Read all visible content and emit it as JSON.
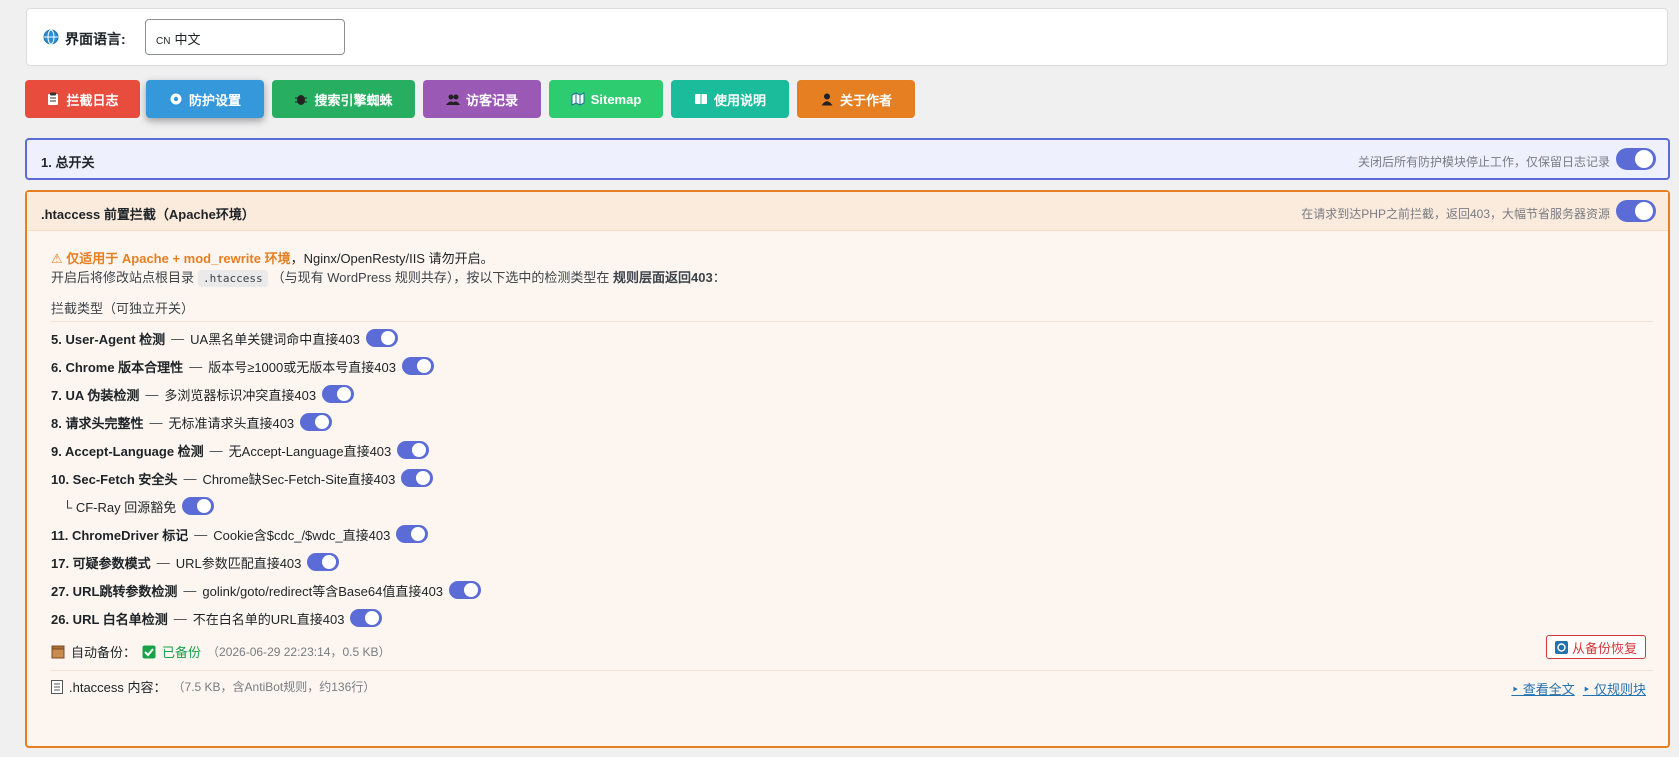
{
  "language": {
    "label": "界面语言:",
    "flag": "CN",
    "selected": "中文"
  },
  "tabs": [
    {
      "label": "拦截日志",
      "icon": "clipboard-icon",
      "color": "#e74c3c"
    },
    {
      "label": "防护设置",
      "icon": "gear-icon",
      "color": "#3498db"
    },
    {
      "label": "搜索引擎蜘蛛",
      "icon": "bug-icon",
      "color": "#27ae60"
    },
    {
      "label": "访客记录",
      "icon": "users-icon",
      "color": "#9b59b6"
    },
    {
      "label": "Sitemap",
      "icon": "map-icon",
      "color": "#2ecc71"
    },
    {
      "label": "使用说明",
      "icon": "book-icon",
      "color": "#1abc9c"
    },
    {
      "label": "关于作者",
      "icon": "user-icon",
      "color": "#e67e22"
    }
  ],
  "master": {
    "title": "1. 总开关",
    "hint": "关闭后所有防护模块停止工作，仅保留日志记录",
    "enabled": true
  },
  "htaccess": {
    "title": ".htaccess 前置拦截（Apache环境）",
    "hint": "在请求到达PHP之前拦截，返回403，大幅节省服务器资源",
    "enabled": true,
    "warn_highlight": "仅适用于 Apache + mod_rewrite 环境",
    "warn_rest": "，Nginx/OpenResty/IIS 请勿开启。",
    "desc_pre": "开启后将修改站点根目录",
    "desc_code": ".htaccess",
    "desc_mid": "（与现有 WordPress 规则共存），按以下选中的检测类型在",
    "desc_bold": "规则层面返回403",
    "desc_end": "：",
    "section_label": "拦截类型（可独立开关）",
    "checks": [
      {
        "name": "5. User-Agent 检测",
        "desc": "UA黑名单关键词命中直接403",
        "enabled": true
      },
      {
        "name": "6. Chrome 版本合理性",
        "desc": "版本号≥1000或无版本号直接403",
        "enabled": true
      },
      {
        "name": "7. UA 伪装检测",
        "desc": "多浏览器标识冲突直接403",
        "enabled": true
      },
      {
        "name": "8. 请求头完整性",
        "desc": "无标准请求头直接403",
        "enabled": true
      },
      {
        "name": "9. Accept-Language 检测",
        "desc": "无Accept-Language直接403",
        "enabled": true
      },
      {
        "name": "10. Sec-Fetch 安全头",
        "desc": "Chrome缺Sec-Fetch-Site直接403",
        "enabled": true
      },
      {
        "name": "11. ChromeDriver 标记",
        "desc": "Cookie含$cdc_/$wdc_直接403",
        "enabled": true
      },
      {
        "name": "17. 可疑参数模式",
        "desc": "URL参数匹配直接403",
        "enabled": true
      },
      {
        "name": "27. URL跳转参数检测",
        "desc": "golink/goto/redirect等含Base64值直接403",
        "enabled": true
      },
      {
        "name": "26. URL 白名单检测",
        "desc": "不在白名单的URL直接403",
        "enabled": true
      }
    ],
    "sub_check": {
      "label": "└ CF-Ray 回源豁免",
      "enabled": true
    },
    "separator": "—",
    "backup": {
      "label": "自动备份：",
      "status": "已备份",
      "meta": "（2026-06-29 22:23:14，0.5 KB）",
      "restore_label": "从备份恢复"
    },
    "content": {
      "label": ".htaccess 内容：",
      "meta": "（7.5 KB，含AntiBot规则，约136行）",
      "view_full": "‣ 查看全文",
      "rules_only": "‣ 仅规则块"
    }
  }
}
